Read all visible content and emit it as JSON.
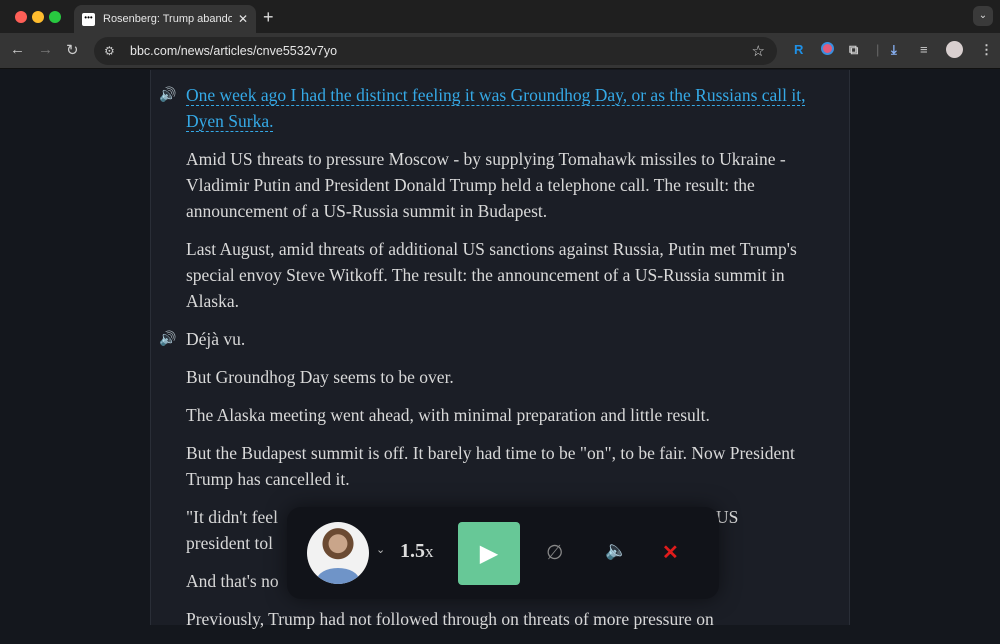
{
  "browser": {
    "tab_title": "Rosenberg: Trump abandons",
    "favicon": "•••",
    "url": "bbc.com/news/articles/cnve5532v7yo",
    "ext_r": "R"
  },
  "article": {
    "p1": "One week ago I had the distinct feeling it was Groundhog Day, or as the Russians call it, Dyen Surka.",
    "p2": "Amid US threats to pressure Moscow - by supplying Tomahawk missiles to Ukraine - Vladimir Putin and President Donald Trump held a telephone call. The result: the announcement of a US-Russia summit in Budapest.",
    "p3": "Last August, amid threats of additional US sanctions against Russia, Putin met Trump's special envoy Steve Witkoff. The result: the announcement of a US-Russia summit in Alaska.",
    "p4": "Déjà vu.",
    "p5": "But Groundhog Day seems to be over.",
    "p6": "The Alaska meeting went ahead, with minimal preparation and little result.",
    "p7": "But the Budapest summit is off. It barely had time to be \"on\", to be fair. Now President Trump has cancelled it.",
    "p8_left": "\"It didn't feel",
    "p8_right": "US",
    "p8_line2": "president tol",
    "p9": "And that's no",
    "p10": "Previously, Trump had not followed through on threats of more pressure on"
  },
  "player": {
    "speed": "1.5",
    "speed_unit": "x",
    "accent": "#67c897",
    "close_color": "#e01b1b"
  }
}
